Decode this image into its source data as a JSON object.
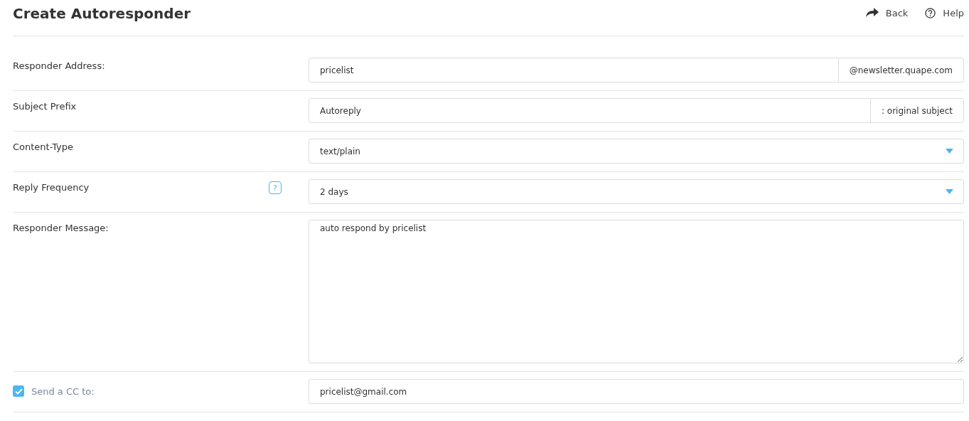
{
  "header": {
    "title": "Create Autoresponder",
    "actions": [
      {
        "kind": "back",
        "label": "Back"
      },
      {
        "kind": "help",
        "label": "Help"
      }
    ]
  },
  "fields": [
    {
      "kind": "addon",
      "label": "Responder Address:",
      "value": "pricelist",
      "addon": "@newsletter.quape.com"
    },
    {
      "kind": "addon",
      "label": "Subject Prefix",
      "value": "Autoreply",
      "addon": ": original subject"
    },
    {
      "kind": "select",
      "label": "Content-Type",
      "value": "text/plain"
    },
    {
      "kind": "select",
      "label": "Reply Frequency",
      "value": "2 days",
      "help": "?"
    },
    {
      "kind": "textarea",
      "label": "Responder Message:",
      "value": "auto respond by pricelist"
    },
    {
      "kind": "checkbox",
      "label": "Send a CC to:",
      "checked": true,
      "value": "pricelist@gmail.com"
    }
  ]
}
